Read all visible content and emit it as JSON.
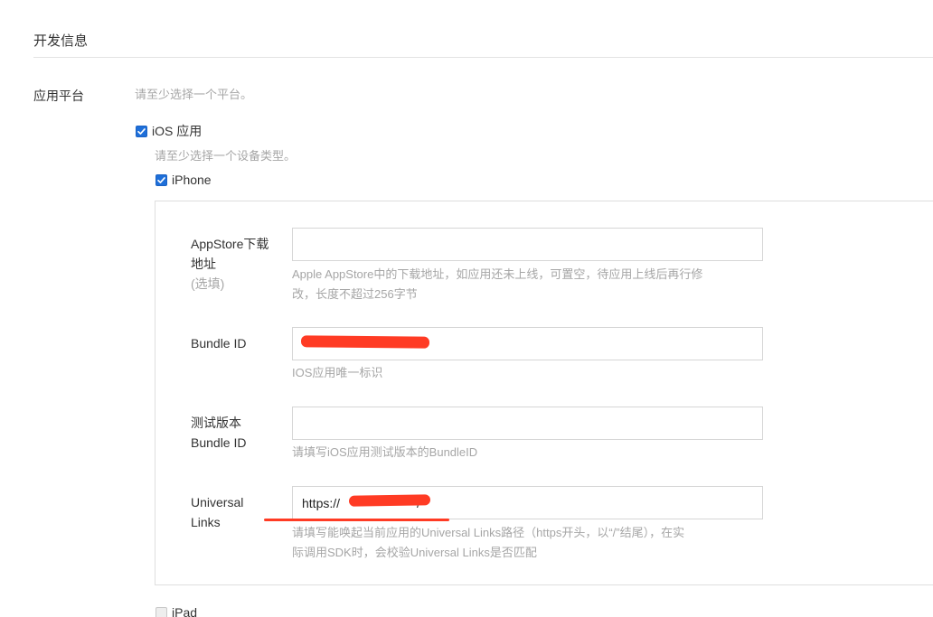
{
  "section": {
    "title": "开发信息"
  },
  "platform": {
    "label": "应用平台",
    "hint": "请至少选择一个平台。",
    "ios": {
      "label": "iOS 应用",
      "checked": true,
      "device_hint": "请至少选择一个设备类型。",
      "iphone": {
        "label": "iPhone",
        "checked": true,
        "fields": {
          "appstore": {
            "label_line1": "AppStore下载",
            "label_line2": "地址",
            "label_optional": "(选填)",
            "value": "",
            "hint_line1": "Apple AppStore中的下载地址，如应用还未上线，可置空，待应用上线后再行修",
            "hint_line2": "改，长度不超过256字节"
          },
          "bundle_id": {
            "label": "Bundle ID",
            "value": "",
            "hint": "IOS应用唯一标识"
          },
          "test_bundle_id": {
            "label_line1": "测试版本",
            "label_line2": "Bundle ID",
            "value": "",
            "hint": "请填写iOS应用测试版本的BundleID"
          },
          "universal_links": {
            "label_line1": "Universal",
            "label_line2": "Links",
            "value_prefix": "https://",
            "value_suffix": "/",
            "hint_line1": "请填写能唤起当前应用的Universal Links路径（https开头，以“/”结尾），在实",
            "hint_line2": "际调用SDK时，会校验Universal Links是否匹配"
          }
        }
      },
      "ipad": {
        "label": "iPad",
        "checked": false
      }
    }
  },
  "colors": {
    "checkbox_checked": "#1e6fd9",
    "redaction": "#ff3b24"
  }
}
